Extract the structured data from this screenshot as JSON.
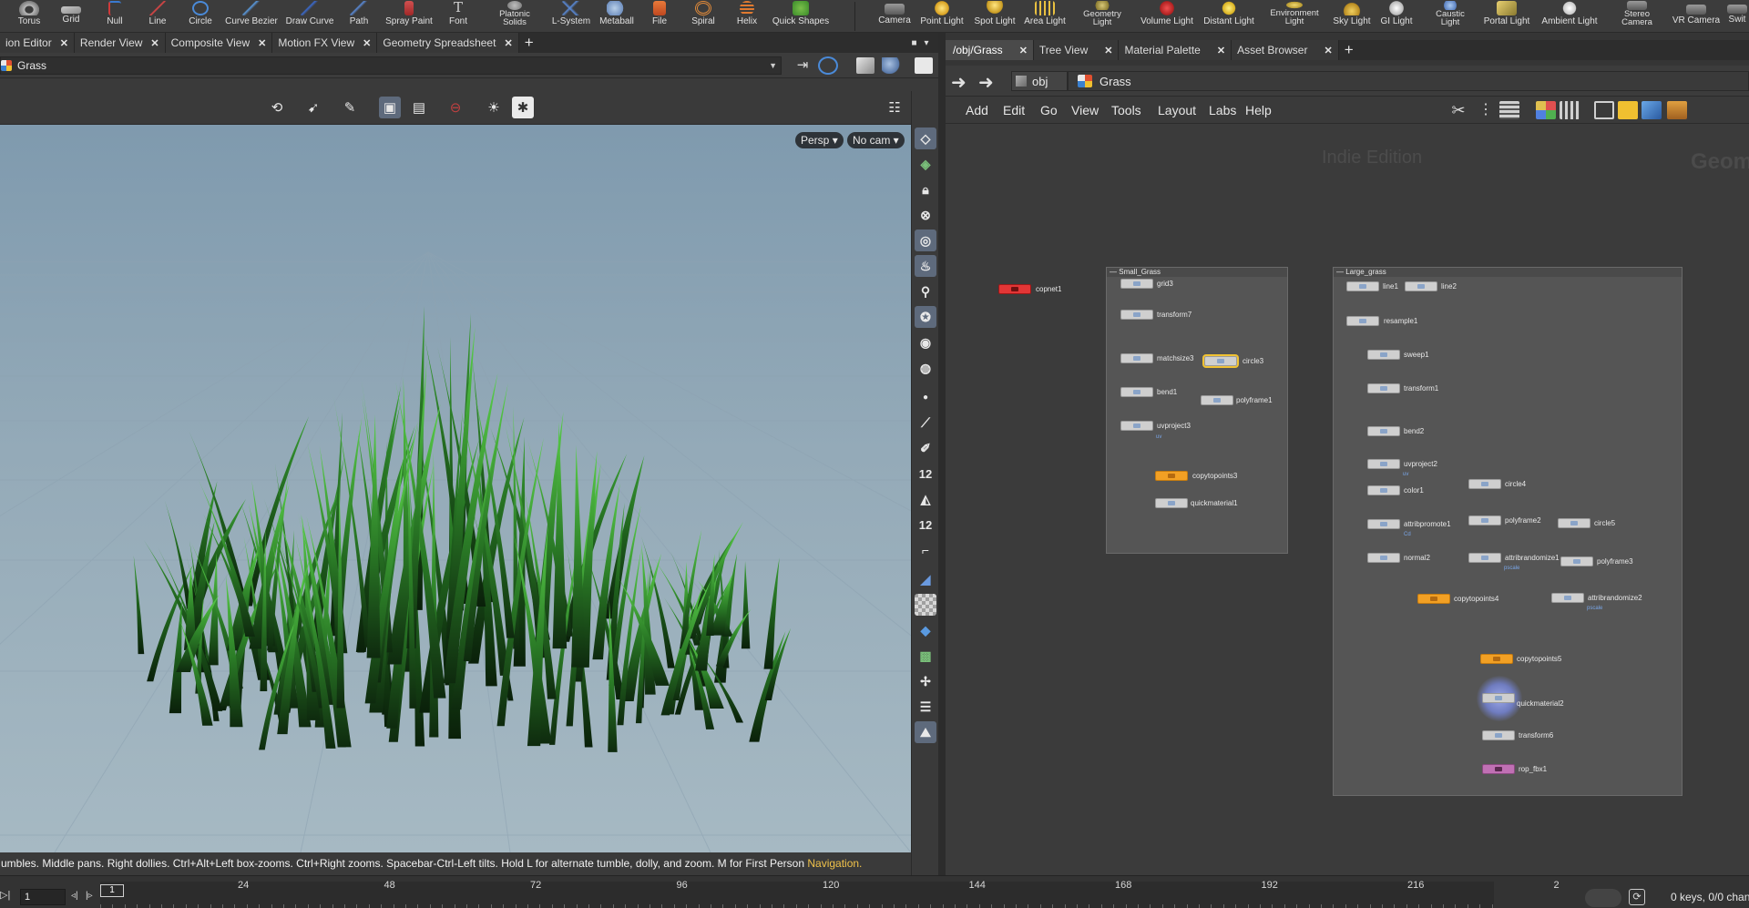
{
  "shelf": {
    "left_tools": [
      {
        "name": "torus",
        "label": "Torus",
        "icon": "torus-icon"
      },
      {
        "name": "grid",
        "label": "Grid",
        "icon": "grid-icon"
      },
      {
        "name": "null",
        "label": "Null",
        "icon": "null-icon"
      },
      {
        "name": "line",
        "label": "Line",
        "icon": "line-icon"
      },
      {
        "name": "circle",
        "label": "Circle",
        "icon": "circle-icon"
      },
      {
        "name": "curve-bezier",
        "label": "Curve Bezier",
        "icon": "curve-bezier-icon"
      },
      {
        "name": "draw-curve",
        "label": "Draw Curve",
        "icon": "draw-curve-icon"
      },
      {
        "name": "path",
        "label": "Path",
        "icon": "path-icon"
      },
      {
        "name": "spray-paint",
        "label": "Spray Paint",
        "icon": "spray-paint-icon"
      },
      {
        "name": "font",
        "label": "Font",
        "icon": "font-icon"
      },
      {
        "name": "platonic-solids",
        "label": "Platonic Solids",
        "icon": "platonic-solids-icon"
      },
      {
        "name": "l-system",
        "label": "L-System",
        "icon": "l-system-icon"
      },
      {
        "name": "metaball",
        "label": "Metaball",
        "icon": "metaball-icon"
      },
      {
        "name": "file",
        "label": "File",
        "icon": "file-icon"
      },
      {
        "name": "spiral",
        "label": "Spiral",
        "icon": "spiral-icon"
      },
      {
        "name": "helix",
        "label": "Helix",
        "icon": "helix-icon"
      },
      {
        "name": "quick-shapes",
        "label": "Quick Shapes",
        "icon": "quick-shapes-icon"
      }
    ],
    "right_tools": [
      {
        "name": "camera",
        "label": "Camera",
        "icon": "camera-icon"
      },
      {
        "name": "point-light",
        "label": "Point Light",
        "icon": "point-light-icon"
      },
      {
        "name": "spot-light",
        "label": "Spot Light",
        "icon": "spot-light-icon"
      },
      {
        "name": "area-light",
        "label": "Area Light",
        "icon": "area-light-icon"
      },
      {
        "name": "geometry-light",
        "label": "Geometry Light",
        "icon": "geometry-light-icon"
      },
      {
        "name": "volume-light",
        "label": "Volume Light",
        "icon": "volume-light-icon"
      },
      {
        "name": "distant-light",
        "label": "Distant Light",
        "icon": "distant-light-icon"
      },
      {
        "name": "environment-light",
        "label": "Environment Light",
        "icon": "environment-light-icon"
      },
      {
        "name": "sky-light",
        "label": "Sky Light",
        "icon": "sky-light-icon"
      },
      {
        "name": "gi-light",
        "label": "GI Light",
        "icon": "gi-light-icon"
      },
      {
        "name": "caustic-light",
        "label": "Caustic Light",
        "icon": "caustic-light-icon"
      },
      {
        "name": "portal-light",
        "label": "Portal Light",
        "icon": "portal-light-icon"
      },
      {
        "name": "ambient-light",
        "label": "Ambient Light",
        "icon": "ambient-light-icon"
      },
      {
        "name": "stereo-camera",
        "label": "Stereo Camera",
        "icon": "stereo-camera-icon"
      },
      {
        "name": "vr-camera",
        "label": "VR Camera",
        "icon": "vr-camera-icon"
      },
      {
        "name": "switcher",
        "label": "Swit",
        "icon": "switcher-icon"
      }
    ]
  },
  "left_tabs": [
    {
      "label": "ion Editor",
      "active": false
    },
    {
      "label": "Render View",
      "active": false
    },
    {
      "label": "Composite View",
      "active": false
    },
    {
      "label": "Motion FX View",
      "active": false
    },
    {
      "label": "Geometry Spreadsheet",
      "active": false
    }
  ],
  "right_tabs": [
    {
      "label": "/obj/Grass",
      "active": true
    },
    {
      "label": "Tree View",
      "active": false
    },
    {
      "label": "Material Palette",
      "active": false
    },
    {
      "label": "Asset Browser",
      "active": false
    }
  ],
  "viewport": {
    "object_path": "Grass",
    "view_label": "Persp",
    "camera_label": "No cam",
    "nav_hint_text": "umbles. Middle pans. Right dollies. Ctrl+Alt+Left box-zooms. Ctrl+Right zooms. Spacebar-Ctrl-Left tilts. Hold L for alternate tumble, dolly, and zoom. M for First Person ",
    "nav_hint_highlight": "Navigation.",
    "side_count_a": "12",
    "side_count_b": "12"
  },
  "network": {
    "path_root": "obj",
    "path_node": "Grass",
    "menu": [
      "Add",
      "Edit",
      "Go",
      "View",
      "Tools",
      "Layout",
      "Labs",
      "Help"
    ],
    "watermark_edition": "Indie Edition",
    "watermark_context": "Geom",
    "box_small": "Small_Grass",
    "box_large": "Large_grass",
    "nodes": {
      "copnet1": "copnet1",
      "grid3": "grid3",
      "transform7": "transform7",
      "matchsize3": "matchsize3",
      "circle3": "circle3",
      "bend1": "bend1",
      "polyframe1": "polyframe1",
      "uvproject3": "uvproject3",
      "copytopoints3": "copytopoints3",
      "quickmaterial1": "quickmaterial1",
      "line1": "line1",
      "line2": "line2",
      "resample1": "resample1",
      "sweep1": "sweep1",
      "transform1": "transform1",
      "bend2": "bend2",
      "uvproject2": "uvproject2",
      "circle4": "circle4",
      "color1": "color1",
      "attribpromote1": "attribpromote1",
      "polyframe2": "polyframe2",
      "circle5": "circle5",
      "normal2": "normal2",
      "attribrandomize1": "attribrandomize1",
      "polyframe3": "polyframe3",
      "copytopoints4": "copytopoints4",
      "attribrandomize2": "attribrandomize2",
      "copytopoints5": "copytopoints5",
      "quickmaterial2": "quickmaterial2",
      "transform6": "transform6",
      "rop_fbx1": "rop_fbx1"
    },
    "sublabels": {
      "uv_a": "uv",
      "uv_b": "uv",
      "cd": "Cd",
      "pscale_a": "pscale",
      "pscale_b": "pscale"
    }
  },
  "timeline": {
    "current_frame": "1",
    "marker_frame": "1",
    "ticks": [
      "24",
      "48",
      "72",
      "96",
      "120",
      "144",
      "168",
      "192",
      "216",
      "2"
    ],
    "keys_status": "0 keys, 0/0 chan"
  },
  "colors": {
    "node_orange": "#f2a024",
    "node_red": "#e23636",
    "node_pink": "#c070b4",
    "node_gray": "#cfcfcf",
    "highlight_yellow": "#f0c24a",
    "toggle_blue": "#5e6a7c",
    "grass_green": "#3fae3a"
  }
}
